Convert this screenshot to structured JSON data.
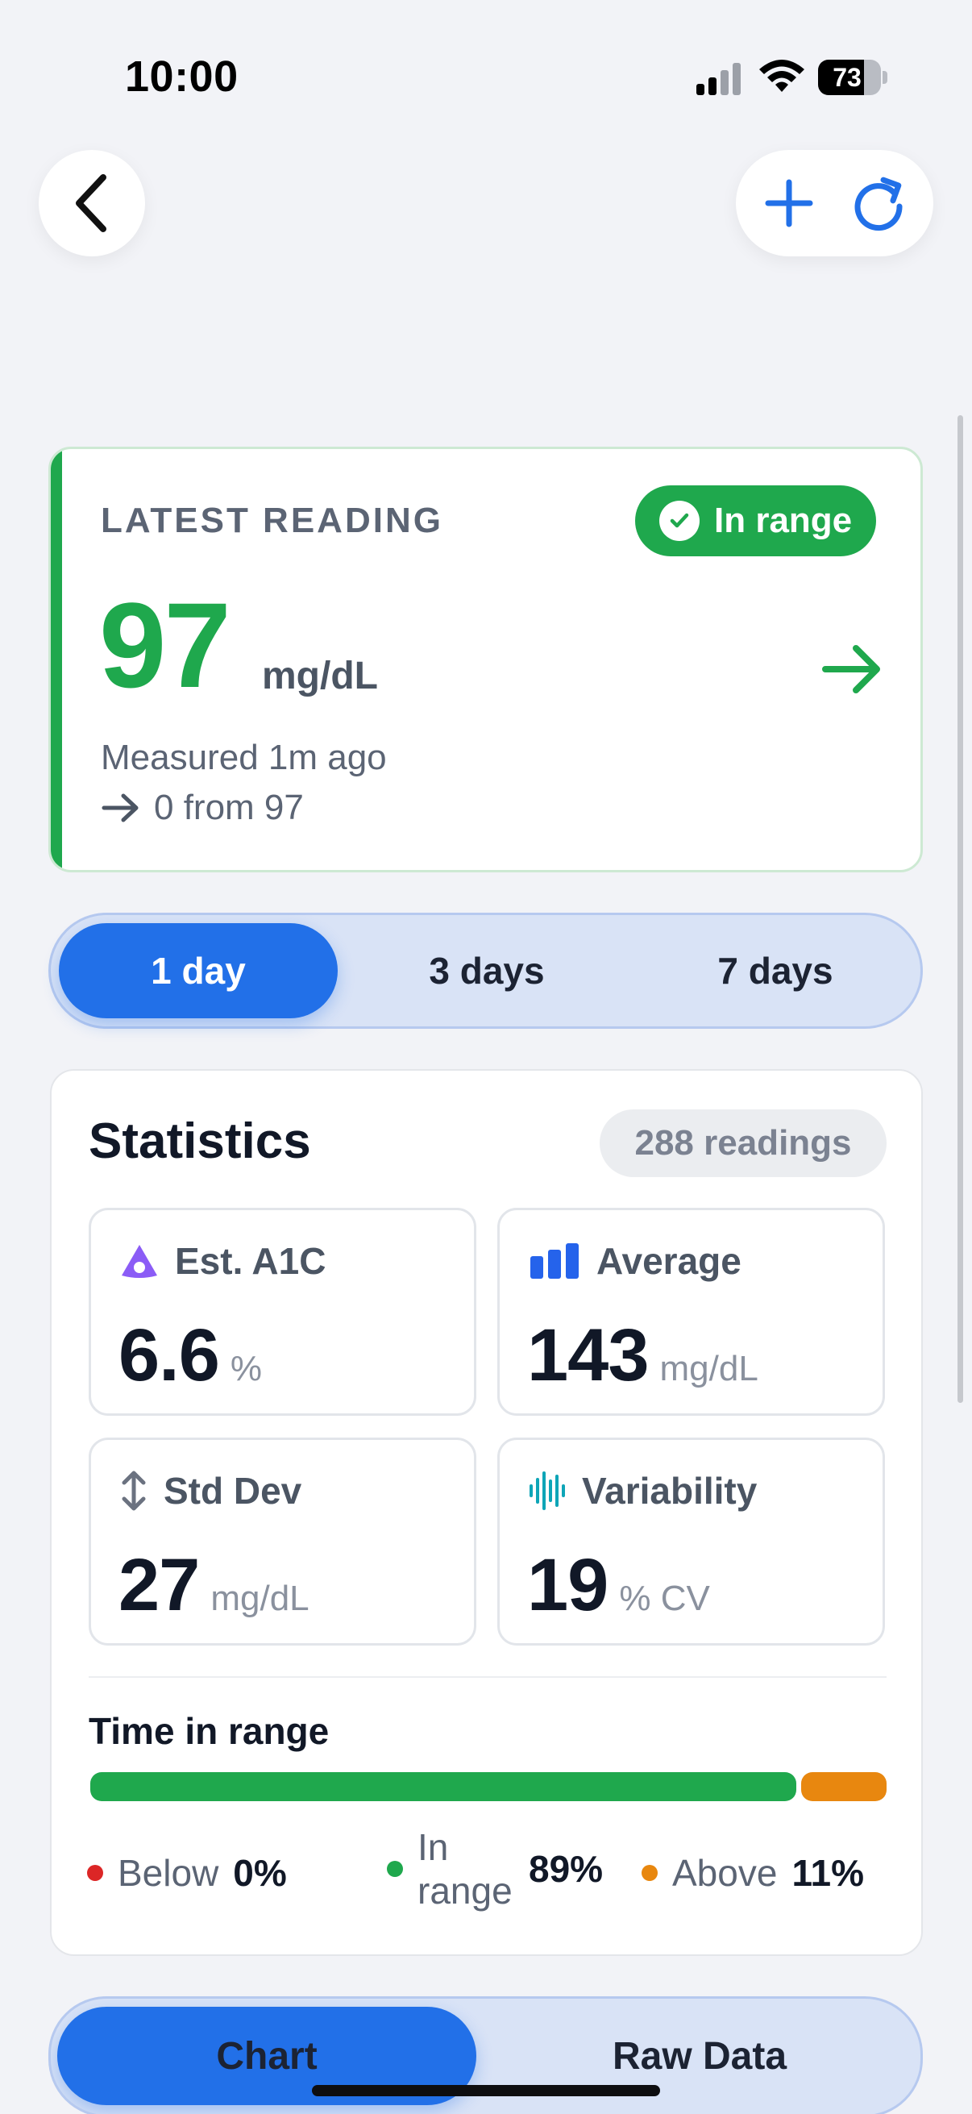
{
  "status_bar": {
    "time": "10:00",
    "battery_level": "73",
    "icons": [
      "cellular-signal-icon",
      "wifi-icon",
      "battery-icon"
    ]
  },
  "nav": {
    "back_icon": "chevron-left-icon",
    "add_icon": "plus-icon",
    "refresh_icon": "refresh-icon"
  },
  "latest_reading": {
    "label": "LATEST READING",
    "status": "In range",
    "value": "97",
    "unit": "mg/dL",
    "measured": "Measured 1m ago",
    "delta": "0 from 97",
    "trend_icon": "arrow-right-icon"
  },
  "range_selector": {
    "options": [
      "1 day",
      "3 days",
      "7 days"
    ],
    "selected": "1 day"
  },
  "statistics": {
    "title": "Statistics",
    "readings_count": "288 readings",
    "metrics": [
      {
        "label": "Est. A1C",
        "value": "6.6",
        "unit": "%",
        "icon": "drop-icon",
        "icon_color": "#8b5cf6"
      },
      {
        "label": "Average",
        "value": "143",
        "unit": "mg/dL",
        "icon": "bar-chart-icon",
        "icon_color": "#2563eb"
      },
      {
        "label": "Std Dev",
        "value": "27",
        "unit": "mg/dL",
        "icon": "up-down-arrows-icon",
        "icon_color": "#6b7280"
      },
      {
        "label": "Variability",
        "value": "19",
        "unit": "% CV",
        "icon": "waveform-icon",
        "icon_color": "#0ea5b7"
      }
    ],
    "time_in_range": {
      "title": "Time in range",
      "below": {
        "label": "Below",
        "value": "0%",
        "fraction": 0.0,
        "color": "#dc2626"
      },
      "in_range": {
        "label": "In range",
        "value": "89%",
        "fraction": 0.89,
        "color": "#1fa84d"
      },
      "above": {
        "label": "Above",
        "value": "11%",
        "fraction": 0.11,
        "color": "#e8870f"
      }
    }
  },
  "view_toggle": {
    "options": [
      "Chart",
      "Raw Data"
    ],
    "selected": "Chart"
  },
  "colors": {
    "accent_blue": "#2270e8",
    "in_range_green": "#1fa84d",
    "above_orange": "#e8870f",
    "below_red": "#dc2626"
  }
}
